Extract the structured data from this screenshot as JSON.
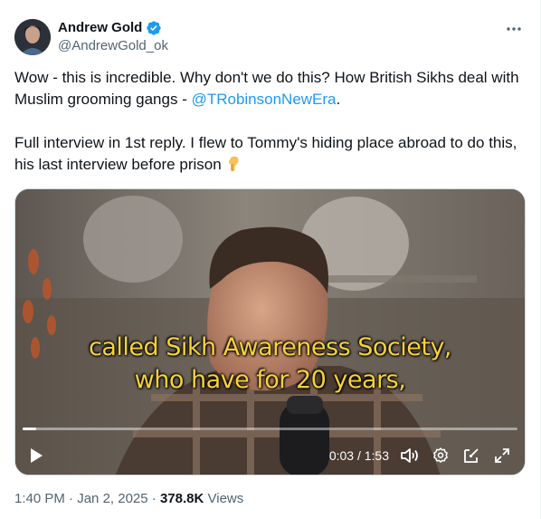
{
  "author": {
    "name": "Andrew Gold",
    "handle": "@AndrewGold_ok",
    "avatar_icon": "profile-avatar",
    "verified_icon": "verified-badge-icon",
    "verified_color": "#1d9bf0"
  },
  "menu": {
    "icon": "more-horizontal-icon"
  },
  "tweet": {
    "line1_prefix": "Wow - this is incredible. Why don't we do this? How British Sikhs deal with Muslim grooming gangs - ",
    "mention": "@TRobinsonNewEra",
    "line1_suffix": ".",
    "line2": "Full interview in 1st reply. I flew to Tommy's hiding place abroad to do this, his last interview before prison",
    "emoji_icon": "pointing-down-emoji"
  },
  "video": {
    "caption_line1": "called Sikh Awareness Society,",
    "caption_line2": "who have for 20 years,",
    "timecode": "0:03 / 1:53",
    "progress": 0.027,
    "caption_color": "#f7d23a",
    "icons": [
      "play-icon",
      "volume-icon",
      "settings-icon",
      "picture-in-picture-icon",
      "fullscreen-icon"
    ]
  },
  "meta": {
    "time": "1:40 PM",
    "separator": "·",
    "date": "Jan 2, 2025",
    "views_count": "378.8K",
    "views_label": "Views"
  },
  "colors": {
    "accent": "#1d9bf0",
    "text": "#0f1419",
    "secondary": "#536471"
  }
}
